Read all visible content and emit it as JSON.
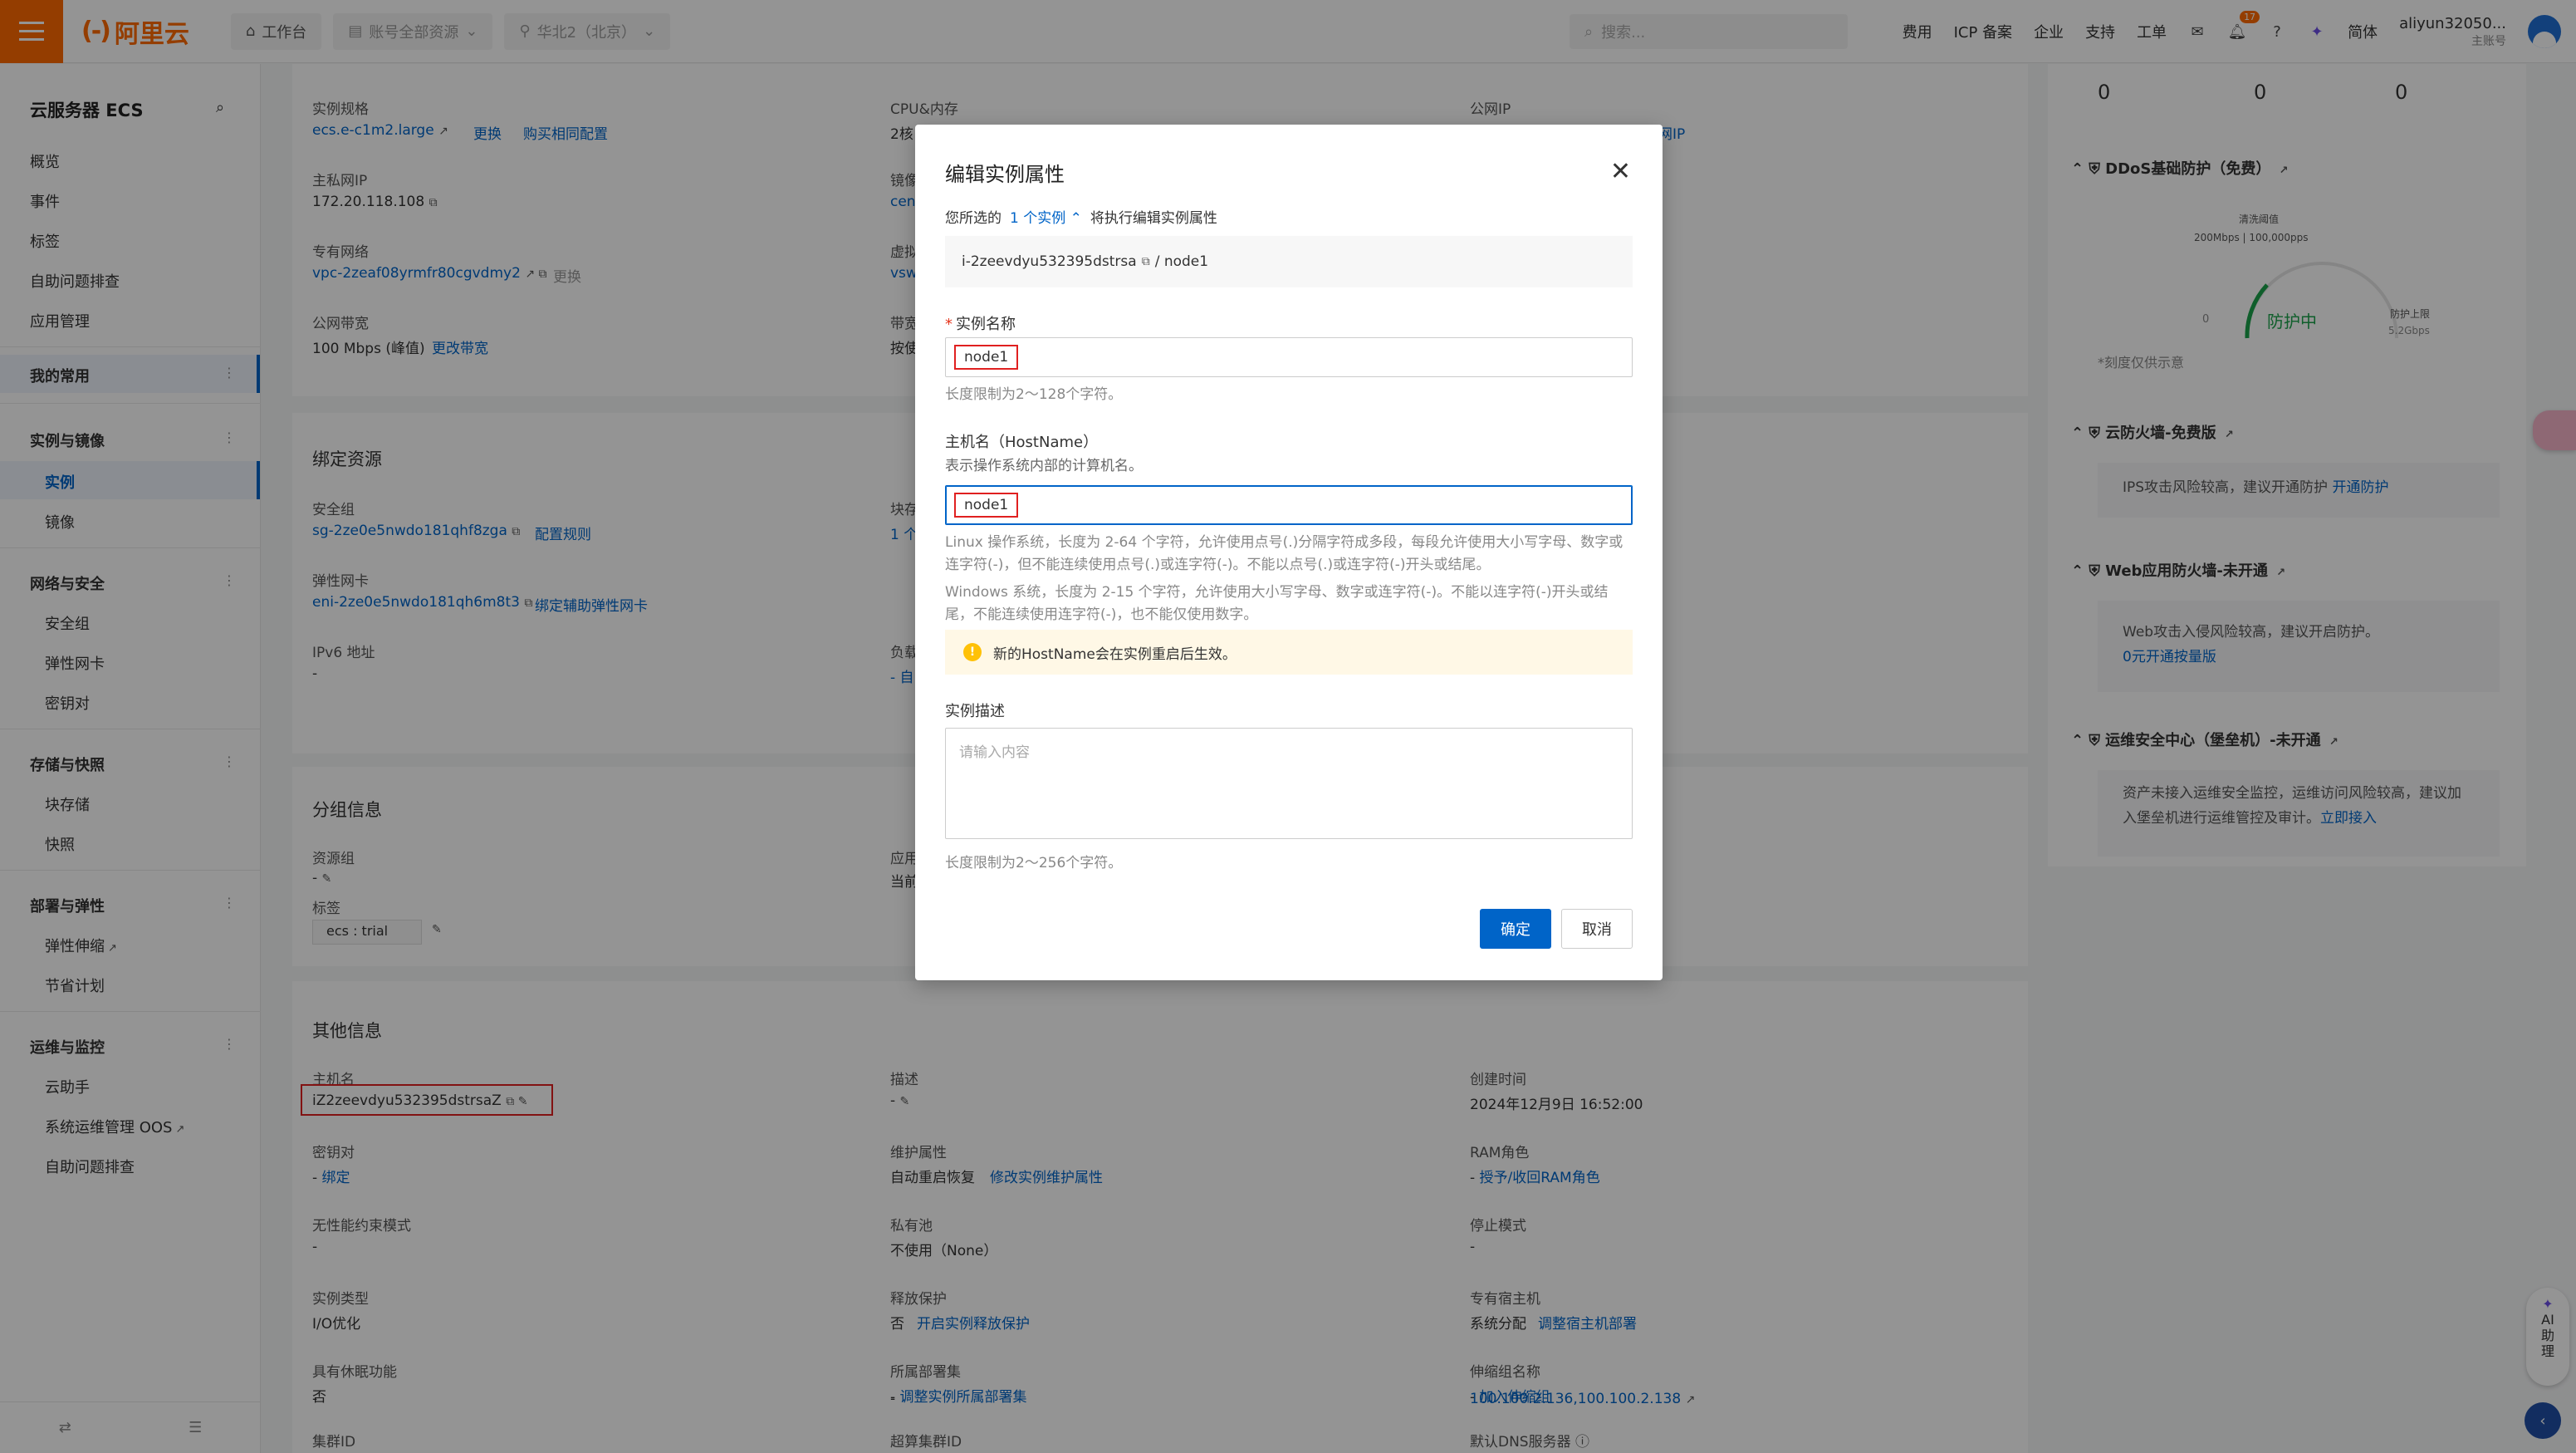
{
  "topbar": {
    "brand": "阿里云",
    "workspace": "工作台",
    "resource_group": "账号全部资源",
    "region": "华北2（北京）",
    "search_placeholder": "搜索...",
    "nav": [
      "费用",
      "ICP 备案",
      "企业",
      "支持",
      "工单"
    ],
    "notification_count": "17",
    "lang": "简体",
    "user_name": "aliyun32050...",
    "user_role": "主账号"
  },
  "sidebar": {
    "title": "云服务器 ECS",
    "top_items": [
      "概览",
      "事件",
      "标签",
      "自助问题排查",
      "应用管理"
    ],
    "favorites": "我的常用",
    "groups": [
      {
        "label": "实例与镜像",
        "items": [
          "实例",
          "镜像"
        ]
      },
      {
        "label": "网络与安全",
        "items": [
          "安全组",
          "弹性网卡",
          "密钥对"
        ]
      },
      {
        "label": "存储与快照",
        "items": [
          "块存储",
          "快照"
        ]
      },
      {
        "label": "部署与弹性",
        "items": [
          "弹性伸缩",
          "节省计划"
        ]
      },
      {
        "label": "运维与监控",
        "items": [
          "云助手",
          "系统运维管理 OOS",
          "自助问题排查"
        ]
      }
    ]
  },
  "main": {
    "config": {
      "spec_label": "实例规格",
      "spec_value": "ecs.e-c1m2.large",
      "spec_change": "更换",
      "spec_buy": "购买相同配置",
      "cpu_label": "CPU&内存",
      "cpu_value": "2核",
      "public_ip_label": "公网IP",
      "public_ip_action": "属性公网IP",
      "private_ip_label": "主私网IP",
      "private_ip_value": "172.20.118.108",
      "image_label": "镜像",
      "image_value": "cen",
      "vpc_label": "专有网络",
      "vpc_value": "vpc-2zeaf08yrmfr80cgvdmy2",
      "vpc_action": "更换",
      "vsw_label": "虚拟",
      "vsw_value": "vsw",
      "bandwidth_label": "公网带宽",
      "bandwidth_value": "100 Mbps (峰值)",
      "bandwidth_action": "更改带宽",
      "bw_billing_label": "带宽",
      "bw_billing_value": "按使"
    },
    "bound": {
      "title": "绑定资源",
      "sg_label": "安全组",
      "sg_value": "sg-2ze0e5nwdo181qhf8zga",
      "sg_action": "配置规则",
      "disk_label": "块存",
      "disk_value": "1 个",
      "eni_label": "弹性网卡",
      "eni_value": "eni-2ze0e5nwdo181qh6m8t3",
      "eni_action": "绑定辅助弹性网卡",
      "ipv6_label": "IPv6 地址",
      "ipv6_value": "-",
      "lb_label": "负载",
      "lb_value": "- 自"
    },
    "group": {
      "title": "分组信息",
      "rg_label": "资源组",
      "rg_value": "-",
      "app_label": "应用",
      "app_value": "当前",
      "tag_label": "标签",
      "tag_value": "ecs : trial"
    },
    "other": {
      "title": "其他信息",
      "hostname_label": "主机名",
      "hostname_value": "iZ2zeevdyu532395dstrsaZ",
      "desc_label": "描述",
      "desc_value": "-",
      "created_label": "创建时间",
      "created_value": "2024年12月9日 16:52:00",
      "keypair_label": "密钥对",
      "keypair_action": "绑定",
      "maint_label": "维护属性",
      "maint_value": "自动重启恢复",
      "maint_action": "修改实例维护属性",
      "ram_label": "RAM角色",
      "ram_action": "授予/收回RAM角色",
      "perf_label": "无性能约束模式",
      "perf_value": "-",
      "pool_label": "私有池",
      "pool_value": "不使用（None）",
      "stop_label": "停止模式",
      "stop_value": "-",
      "type_label": "实例类型",
      "type_value": "I/O优化",
      "release_label": "释放保护",
      "release_value": "否",
      "release_action": "开启实例释放保护",
      "dedicated_label": "专有宿主机",
      "dedicated_value": "系统分配",
      "dedicated_action": "调整宿主机部署",
      "hibernate_label": "具有休眠功能",
      "hibernate_value": "否",
      "deploy_label": "所属部署集",
      "deploy_action": "调整实例所属部署集",
      "scaling_label": "伸缩组名称",
      "scaling_action": "加入伸缩组",
      "cluster_label": "集群ID",
      "cluster_value": "-",
      "hpc_label": "超算集群ID",
      "hpc_value": "-",
      "dns_label": "默认DNS服务器",
      "dns_value": "100.100.2.136,100.100.2.138"
    }
  },
  "right_panel": {
    "counts": [
      "0",
      "0",
      "0"
    ],
    "ddos_title": "DDoS基础防护（免费）",
    "ddos_threshold_label": "清洗阈值",
    "ddos_threshold_value": "200Mbps | 100,000pps",
    "ddos_status": "防护中",
    "ddos_zero": "0",
    "ddos_cap_label": "防护上限",
    "ddos_cap_value": "5.2Gbps",
    "ddos_note": "*刻度仅供示意",
    "firewall_title": "云防火墙-免费版",
    "firewall_text": "IPS攻击风险较高，建议开通防护",
    "firewall_action": "开通防护",
    "waf_title": "Web应用防火墙-未开通",
    "waf_text": "Web攻击入侵风险较高，建议开启防护。",
    "waf_action": "0元开通按量版",
    "bastion_title": "运维安全中心（堡垒机）-未开通",
    "bastion_text": "资产未接入运维安全监控，运维访问风险较高，建议加入堡垒机进行运维管控及审计。",
    "bastion_action": "立即接入"
  },
  "assistant": {
    "label": "AI助理"
  },
  "modal": {
    "title": "编辑实例属性",
    "selected_prefix": "您所选的",
    "selected_count": "1 个实例",
    "selected_suffix": "将执行编辑实例属性",
    "instance_id": "i-2zeevdyu532395dstrsa",
    "instance_name_sep": "/ node1",
    "name_label": "实例名称",
    "name_value": "node1",
    "name_hint": "长度限制为2～128个字符。",
    "hostname_label": "主机名（HostName）",
    "hostname_desc": "表示操作系统内部的计算机名。",
    "hostname_value": "node1",
    "linux_hint": "Linux 操作系统，长度为 2-64 个字符，允许使用点号(.)分隔字符成多段，每段允许使用大小写字母、数字或连字符(-)，但不能连续使用点号(.)或连字符(-)。不能以点号(.)或连字符(-)开头或结尾。",
    "windows_hint": "Windows 系统，长度为 2-15 个字符，允许使用大小写字母、数字或连字符(-)。不能以连字符(-)开头或结尾，不能连续使用连字符(-)，也不能仅使用数字。",
    "warning": "新的HostName会在实例重启后生效。",
    "desc_label": "实例描述",
    "desc_placeholder": "请输入内容",
    "desc_hint": "长度限制为2～256个字符。",
    "confirm": "确定",
    "cancel": "取消"
  }
}
